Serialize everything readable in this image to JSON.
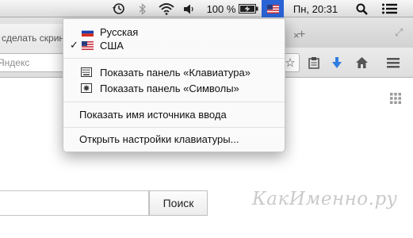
{
  "menubar": {
    "battery_percent": "100 %",
    "clock": "Пн, 20:31",
    "icons": [
      "time-machine-icon",
      "bluetooth-icon",
      "wifi-icon",
      "volume-icon",
      "battery-charging-icon",
      "input-source-flag-icon",
      "spotlight-icon",
      "notification-center-icon"
    ]
  },
  "browser": {
    "tab_left_title": "сделать скрин",
    "url_placeholder": "Яндекс",
    "search_button": "Поиск"
  },
  "input_menu": {
    "sources": [
      {
        "label": "Русская",
        "flag": "ru",
        "checked": false
      },
      {
        "label": "США",
        "flag": "us",
        "checked": true
      }
    ],
    "check_mark": "✓",
    "show_keyboard_viewer": "Показать панель «Клавиатура»",
    "show_character_viewer": "Показать панель «Символы»",
    "show_input_source_name": "Показать имя источника ввода",
    "open_keyboard_preferences": "Открыть настройки клавиатуры..."
  },
  "watermark": "КакИменно.ру",
  "colors": {
    "menu_highlight": "#2a63d6",
    "download_arrow": "#2f7de0"
  }
}
